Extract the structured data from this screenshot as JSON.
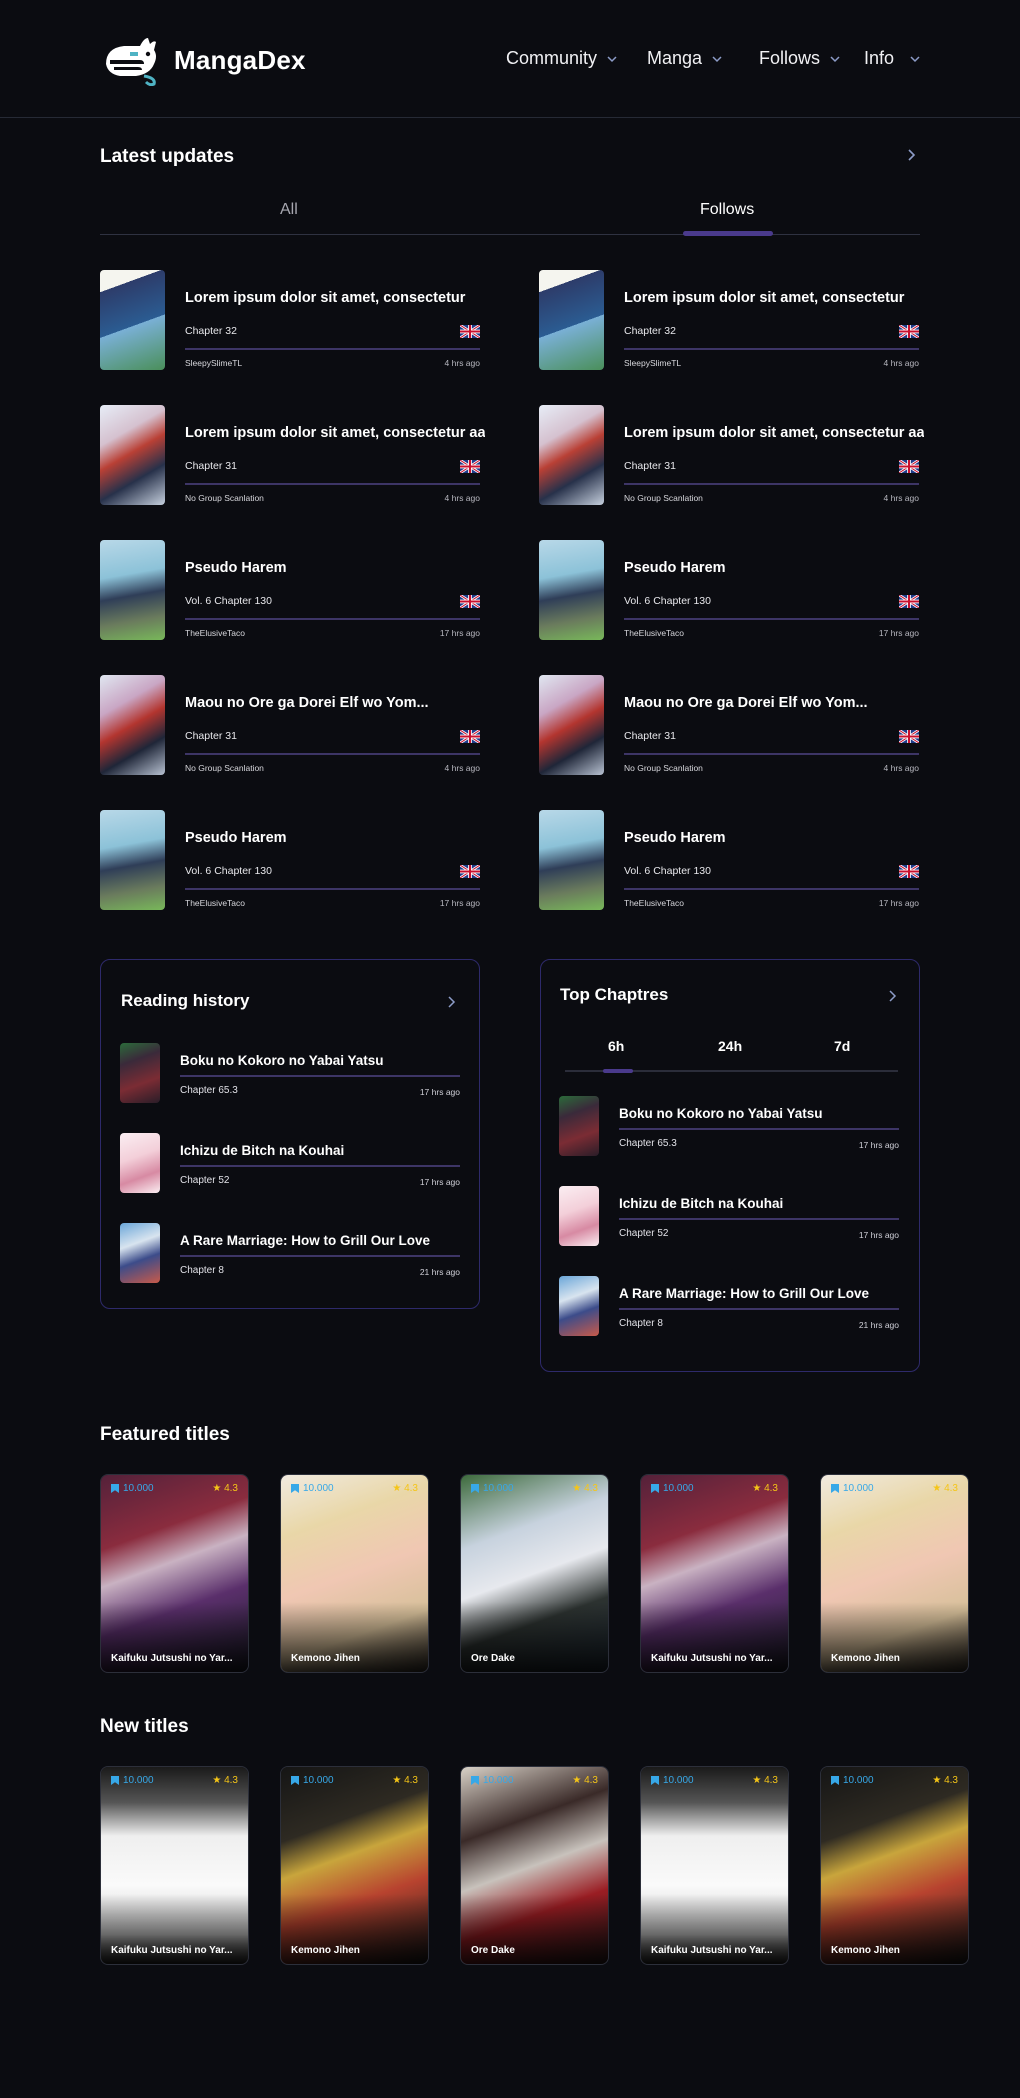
{
  "header": {
    "brand": "MangaDex",
    "nav": [
      {
        "label": "Community"
      },
      {
        "label": "Manga"
      },
      {
        "label": "Follows"
      },
      {
        "label": "Info"
      }
    ]
  },
  "latest_updates": {
    "title": "Latest updates",
    "tabs": [
      "All",
      "Follows"
    ],
    "active_tab": "Follows",
    "columns": [
      [
        {
          "title": "Lorem ipsum dolor sit amet, consectetur",
          "chapter": "Chapter 32",
          "group": "SleepySlimeTL",
          "time": "4 hrs ago"
        },
        {
          "title": "Lorem ipsum dolor sit amet, consectetur aa",
          "chapter": "Chapter 31",
          "group": "No Group Scanlation",
          "time": "4 hrs ago"
        },
        {
          "title": "Pseudo Harem",
          "chapter": "Vol. 6 Chapter 130",
          "group": "TheElusiveTaco",
          "time": "17 hrs ago"
        },
        {
          "title": "Maou no Ore ga Dorei Elf wo Yom...",
          "chapter": "Chapter 31",
          "group": "No Group Scanlation",
          "time": "4 hrs ago"
        },
        {
          "title": "Pseudo Harem",
          "chapter": "Vol. 6 Chapter 130",
          "group": "TheElusiveTaco",
          "time": "17 hrs ago"
        }
      ],
      [
        {
          "title": "Lorem ipsum dolor sit amet, consectetur",
          "chapter": "Chapter 32",
          "group": "SleepySlimeTL",
          "time": "4 hrs ago"
        },
        {
          "title": "Lorem ipsum dolor sit amet, consectetur aa",
          "chapter": "Chapter 31",
          "group": "No Group Scanlation",
          "time": "4 hrs ago"
        },
        {
          "title": "Pseudo Harem",
          "chapter": "Vol. 6 Chapter 130",
          "group": "TheElusiveTaco",
          "time": "17 hrs ago"
        },
        {
          "title": "Maou no Ore ga Dorei Elf wo Yom...",
          "chapter": "Chapter 31",
          "group": "No Group Scanlation",
          "time": "4 hrs ago"
        },
        {
          "title": "Pseudo Harem",
          "chapter": "Vol. 6 Chapter 130",
          "group": "TheElusiveTaco",
          "time": "17 hrs ago"
        }
      ]
    ]
  },
  "reading_history": {
    "title": "Reading history",
    "items": [
      {
        "title": "Boku no Kokoro no Yabai Yatsu",
        "chapter": "Chapter 65.3",
        "time": "17 hrs ago"
      },
      {
        "title": "Ichizu de Bitch na Kouhai",
        "chapter": "Chapter 52",
        "time": "17 hrs ago"
      },
      {
        "title": "A Rare Marriage: How to Grill Our Love",
        "chapter": "Chapter 8",
        "time": "21 hrs ago"
      }
    ]
  },
  "top_chapters": {
    "title": "Top Chaptres",
    "tabs": [
      "6h",
      "24h",
      "7d"
    ],
    "active_tab": "6h",
    "items": [
      {
        "title": "Boku no Kokoro no Yabai Yatsu",
        "chapter": "Chapter 65.3",
        "time": "17 hrs ago"
      },
      {
        "title": "Ichizu de Bitch na Kouhai",
        "chapter": "Chapter 52",
        "time": "17 hrs ago"
      },
      {
        "title": "A Rare Marriage: How to Grill Our Love",
        "chapter": "Chapter 8",
        "time": "21 hrs ago"
      }
    ]
  },
  "featured": {
    "title": "Featured titles",
    "cards": [
      {
        "title": "Kaifuku Jutsushi no Yar...",
        "follows": "10.000",
        "rating": "★ 4.3"
      },
      {
        "title": "Kemono Jihen",
        "follows": "10.000",
        "rating": "★ 4.3"
      },
      {
        "title": "Ore Dake",
        "follows": "10.000",
        "rating": "★ 4.3"
      },
      {
        "title": "Kaifuku Jutsushi no Yar...",
        "follows": "10.000",
        "rating": "★ 4.3"
      },
      {
        "title": "Kemono Jihen",
        "follows": "10.000",
        "rating": "★ 4.3"
      }
    ]
  },
  "new_titles": {
    "title": "New titles",
    "cards": [
      {
        "title": "Kaifuku Jutsushi no Yar...",
        "follows": "10.000",
        "rating": "★ 4.3"
      },
      {
        "title": "Kemono Jihen",
        "follows": "10.000",
        "rating": "★ 4.3"
      },
      {
        "title": "Ore Dake",
        "follows": "10.000",
        "rating": "★ 4.3"
      },
      {
        "title": "Kaifuku Jutsushi no Yar...",
        "follows": "10.000",
        "rating": "★ 4.3"
      },
      {
        "title": "Kemono Jihen",
        "follows": "10.000",
        "rating": "★ 4.3"
      }
    ]
  },
  "colors": {
    "background": "#0b0c11",
    "accent": "#4a3a8c",
    "divider": "#3d3566",
    "panel_border": "#2e2a6b",
    "follows_blue": "#37a8e8",
    "rating_yellow": "#f5c518"
  }
}
